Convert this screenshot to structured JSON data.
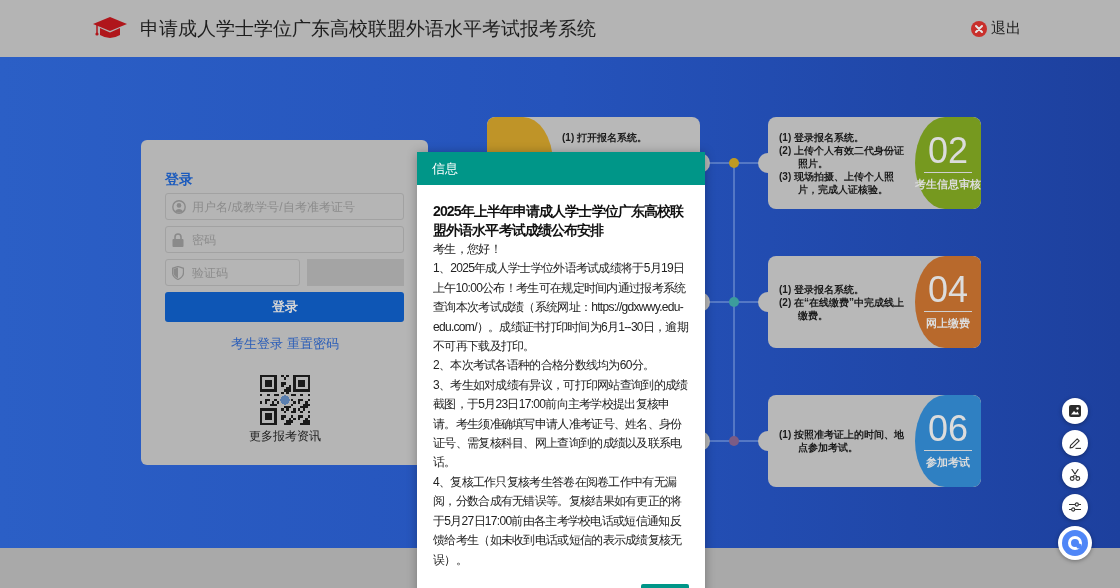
{
  "header": {
    "title": "申请成人学士学位广东高校联盟外语水平考试报考系统",
    "logout": "退出"
  },
  "login": {
    "title": "登录",
    "fields": [
      {
        "kind": "user",
        "placeholder": "用户名/成教学号/自考准考证号"
      },
      {
        "kind": "password",
        "placeholder": "密码"
      },
      {
        "kind": "captcha",
        "placeholder": "验证码"
      }
    ],
    "submit": "登录",
    "links": [
      "考生登录",
      "重置密码"
    ],
    "qr_caption": "更多报考资讯"
  },
  "timeline": {
    "rows": [
      {
        "left": {
          "color": "#bf9428",
          "lines": [
            "(1) 打开报名系统。"
          ]
        },
        "right": {
          "number": "02",
          "title": "考生信息审核",
          "color": "#76991f",
          "lines": [
            "(1) 登录报名系统。",
            "(2) 上传个人有效二代身份证照片。",
            "(3) 现场拍摄、上传个人照片，完成人证核验。"
          ]
        }
      },
      {
        "right": {
          "number": "04",
          "title": "网上缴费",
          "color": "#b8692c",
          "lines": [
            "(1) 登录报名系统。",
            "(2) 在“在线缴费”中完成线上缴费。"
          ]
        }
      },
      {
        "right": {
          "number": "06",
          "title": "参加考试",
          "color": "#2f80c2",
          "lines": [
            "(1) 按照准考证上的时间、地点参加考试。"
          ]
        }
      }
    ]
  },
  "dialog": {
    "title": "信息",
    "heading": "2025年上半年申请成人学士学位广东高校联盟外语水平考试成绩公布安排",
    "paragraphs": [
      "考生，您好！",
      "1、2025年成人学士学位外语考试成绩将于5月19日上午10:00公布！考生可在规定时间内通过报考系统查询本次考试成绩（系统网址：https://gdxwwy.edu-edu.com/）。成绩证书打印时间为6月1--30日，逾期不可再下载及打印。",
      "2、本次考试各语种的合格分数线均为60分。",
      "3、考生如对成绩有异议，可打印网站查询到的成绩截图，于5月23日17:00前向主考学校提出复核申请。考生须准确填写申请人准考证号、姓名、身份证号、需复核科目、网上查询到的成绩以及联系电话。",
      "4、复核工作只复核考生答卷在阅卷工作中有无漏阅，分数合成有无错误等。复核结果如有更正的将于5月27日17:00前由各主考学校电话或短信通知反馈给考生（如未收到电话或短信的表示成绩复核无误）。"
    ]
  },
  "side_tools": [
    {
      "kind": "image"
    },
    {
      "kind": "pen"
    },
    {
      "kind": "scissors"
    },
    {
      "kind": "sliders"
    },
    {
      "kind": "assistant"
    }
  ]
}
